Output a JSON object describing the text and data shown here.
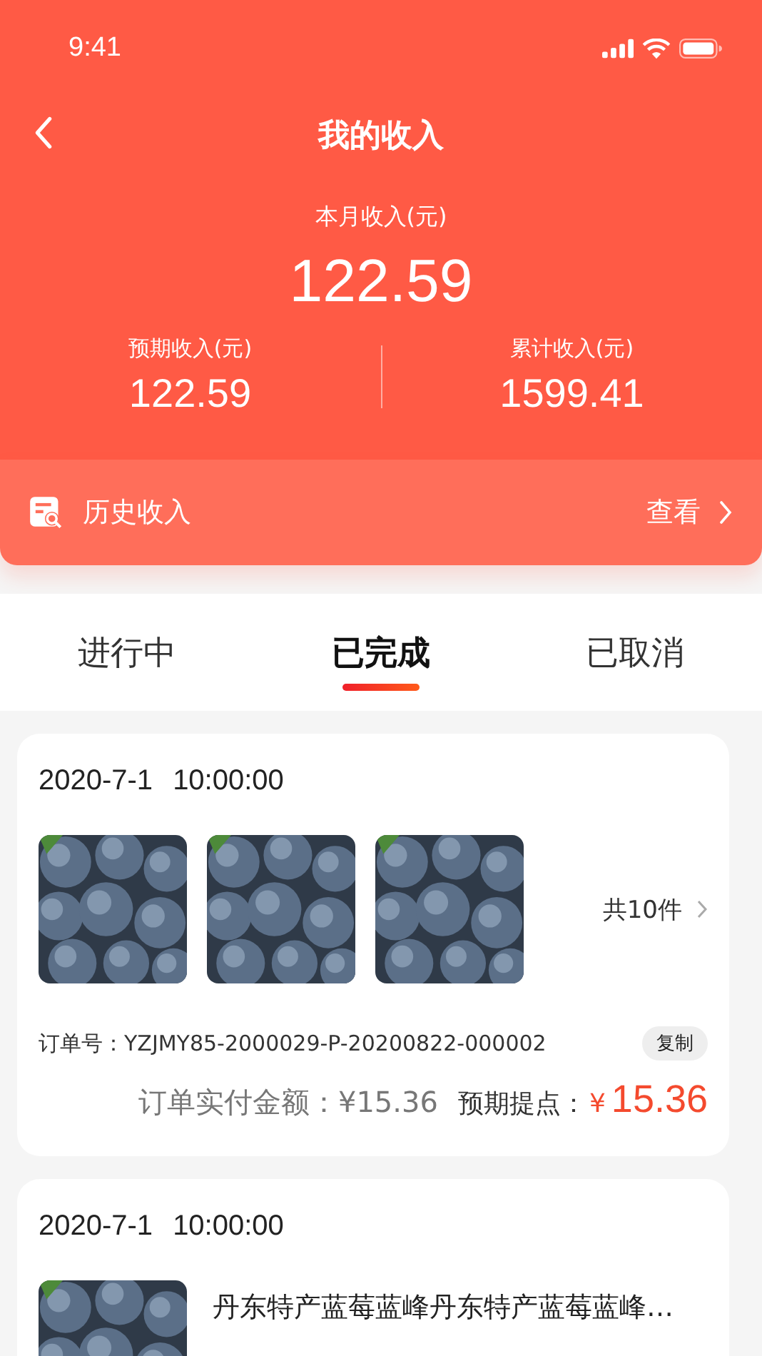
{
  "status_bar": {
    "time": "9:41"
  },
  "header": {
    "title": "我的收入",
    "month_label": "本月收入(元)",
    "month_value": "122.59",
    "stats": [
      {
        "label": "预期收入(元)",
        "value": "122.59"
      },
      {
        "label": "累计收入(元)",
        "value": "1599.41"
      }
    ]
  },
  "history": {
    "label": "历史收入",
    "action": "查看"
  },
  "tabs": [
    {
      "label": "进行中",
      "selected": false
    },
    {
      "label": "已完成",
      "selected": true
    },
    {
      "label": "已取消",
      "selected": false
    }
  ],
  "orders": [
    {
      "kind": "multi",
      "date": "2020-7-1",
      "time": "10:00:00",
      "count": "共10件",
      "order_no_label": "订单号：",
      "order_no": "YZJMY85-2000029-P-20200822-000002",
      "copy": "复制",
      "paid": "订单实付金额：¥15.36",
      "points_label": "预期提点：",
      "points_currency": "¥",
      "points": "15.36"
    },
    {
      "kind": "single",
      "date": "2020-7-1",
      "time": "10:00:00",
      "title": "丹东特产蓝莓蓝峰丹东特产蓝莓蓝峰…"
    }
  ]
}
